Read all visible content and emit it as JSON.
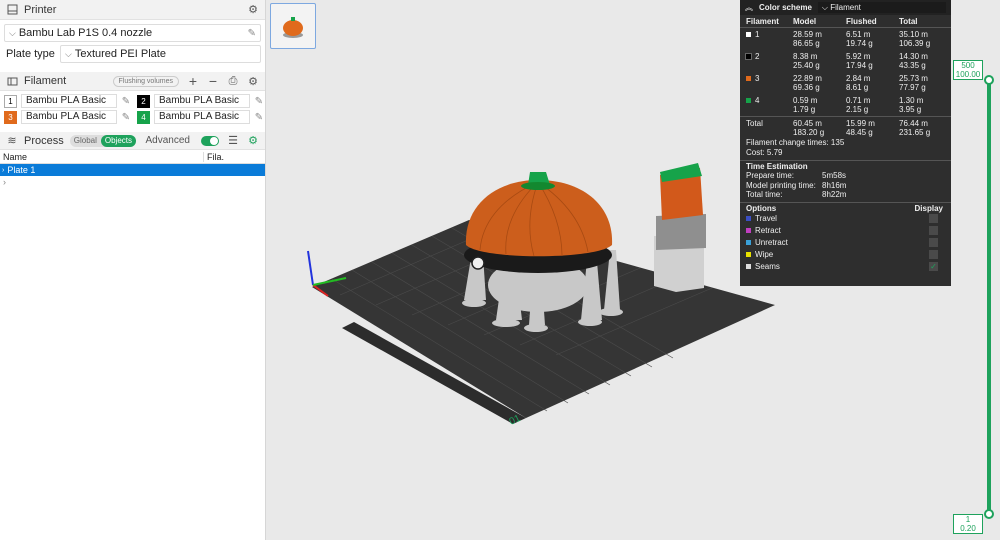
{
  "printer": {
    "title": "Printer",
    "model": "Bambu Lab P1S 0.4 nozzle",
    "plate_type_label": "Plate type",
    "plate_type": "Textured PEI Plate"
  },
  "filament": {
    "title": "Filament",
    "flushing_label": "Flushing volumes",
    "items": [
      {
        "num": "1",
        "name": "Bambu PLA Basic",
        "color": "#ffffff",
        "text": "#000000"
      },
      {
        "num": "2",
        "name": "Bambu PLA Basic",
        "color": "#000000",
        "text": "#ffffff"
      },
      {
        "num": "3",
        "name": "Bambu PLA Basic",
        "color": "#e06a1c",
        "text": "#ffffff"
      },
      {
        "num": "4",
        "name": "Bambu PLA Basic",
        "color": "#16a34a",
        "text": "#ffffff"
      }
    ]
  },
  "process": {
    "title": "Process",
    "global_label": "Global",
    "objects_label": "Objects",
    "advanced_label": "Advanced"
  },
  "objects": {
    "col_name": "Name",
    "col_fila": "Fila.",
    "plate_row": "Plate 1"
  },
  "color_scheme": {
    "title": "Color scheme",
    "selected": "Filament",
    "headers": {
      "filament": "Filament",
      "model": "Model",
      "flushed": "Flushed",
      "total": "Total"
    },
    "rows": [
      {
        "id": "1",
        "color": "#ffffff",
        "model_m": "28.59 m",
        "model_g": "86.65 g",
        "flushed_m": "6.51 m",
        "flushed_g": "19.74 g",
        "total_m": "35.10 m",
        "total_g": "106.39 g"
      },
      {
        "id": "2",
        "color": "#000000",
        "model_m": "8.38 m",
        "model_g": "25.40 g",
        "flushed_m": "5.92 m",
        "flushed_g": "17.94 g",
        "total_m": "14.30 m",
        "total_g": "43.35 g"
      },
      {
        "id": "3",
        "color": "#e06a1c",
        "model_m": "22.89 m",
        "model_g": "69.36 g",
        "flushed_m": "2.84 m",
        "flushed_g": "8.61 g",
        "total_m": "25.73 m",
        "total_g": "77.97 g"
      },
      {
        "id": "4",
        "color": "#16a34a",
        "model_m": "0.59 m",
        "model_g": "1.79 g",
        "flushed_m": "0.71 m",
        "flushed_g": "2.15 g",
        "total_m": "1.30 m",
        "total_g": "3.95 g"
      }
    ],
    "total": {
      "label": "Total",
      "model_m": "60.45 m",
      "model_g": "183.20 g",
      "flushed_m": "15.99 m",
      "flushed_g": "48.45 g",
      "total_m": "76.44 m",
      "total_g": "231.65 g"
    },
    "change_times": "Filament change times: 135",
    "cost": "Cost: 5.79",
    "time_title": "Time Estimation",
    "prepare_label": "Prepare time:",
    "prepare_value": "5m58s",
    "model_time_label": "Model printing time:",
    "model_time_value": "8h16m",
    "total_time_label": "Total time:",
    "total_time_value": "8h22m",
    "options_title": "Options",
    "display_title": "Display",
    "options": [
      {
        "label": "Travel",
        "color": "#3b4fc4",
        "checked": false
      },
      {
        "label": "Retract",
        "color": "#c03fc0",
        "checked": false
      },
      {
        "label": "Unretract",
        "color": "#3aa0d8",
        "checked": false
      },
      {
        "label": "Wipe",
        "color": "#e8e000",
        "checked": false
      },
      {
        "label": "Seams",
        "color": "#dddddd",
        "checked": true
      }
    ]
  },
  "slider": {
    "top_layer": "500",
    "top_height": "100.00",
    "bottom_layer": "1",
    "bottom_height": "0.20"
  },
  "bed_label": "01"
}
